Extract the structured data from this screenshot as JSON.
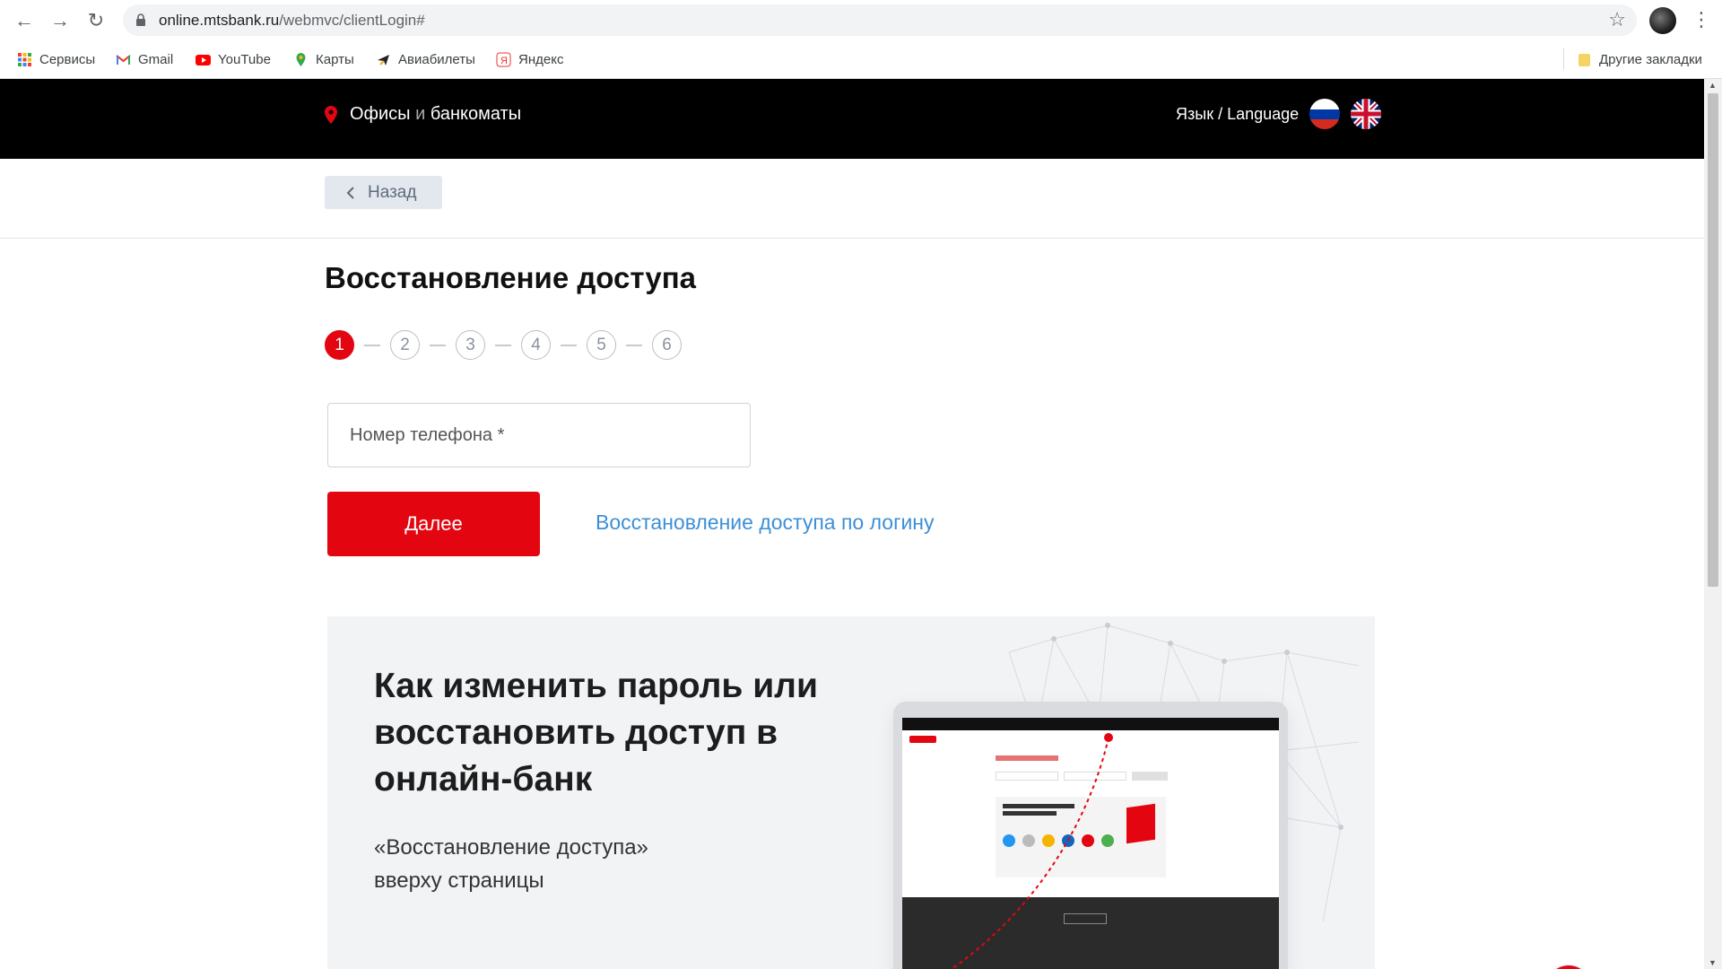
{
  "browser": {
    "url_host": "online.mtsbank.ru",
    "url_path": "/webmvc/clientLogin#",
    "bookmarks": [
      {
        "label": "Сервисы",
        "icon": "apps-grid-icon"
      },
      {
        "label": "Gmail",
        "icon": "gmail-icon"
      },
      {
        "label": "YouTube",
        "icon": "youtube-icon"
      },
      {
        "label": "Карты",
        "icon": "maps-pin-icon"
      },
      {
        "label": "Авиабилеты",
        "icon": "plane-icon"
      },
      {
        "label": "Яндекс",
        "icon": "yandex-icon"
      }
    ],
    "other_bookmarks": "Другие закладки"
  },
  "header": {
    "offices": "Офисы",
    "and": "и",
    "atms": "банкоматы",
    "language": "Язык / Language"
  },
  "back_label": "Назад",
  "title": "Восстановление доступа",
  "steps": [
    "1",
    "2",
    "3",
    "4",
    "5",
    "6"
  ],
  "active_step": 1,
  "form": {
    "phone_placeholder": "Номер телефона *",
    "next_label": "Далее",
    "login_link": "Восстановление доступа по логину"
  },
  "promo": {
    "title": "Как изменить пароль или восстановить доступ в онлайн-банк",
    "subtitle_line1": "«Восстановление доступа»",
    "subtitle_line2": "вверху страницы"
  },
  "colors": {
    "brand_red": "#e30611",
    "link_blue": "#3d8fd6",
    "header_bg": "#000000"
  }
}
